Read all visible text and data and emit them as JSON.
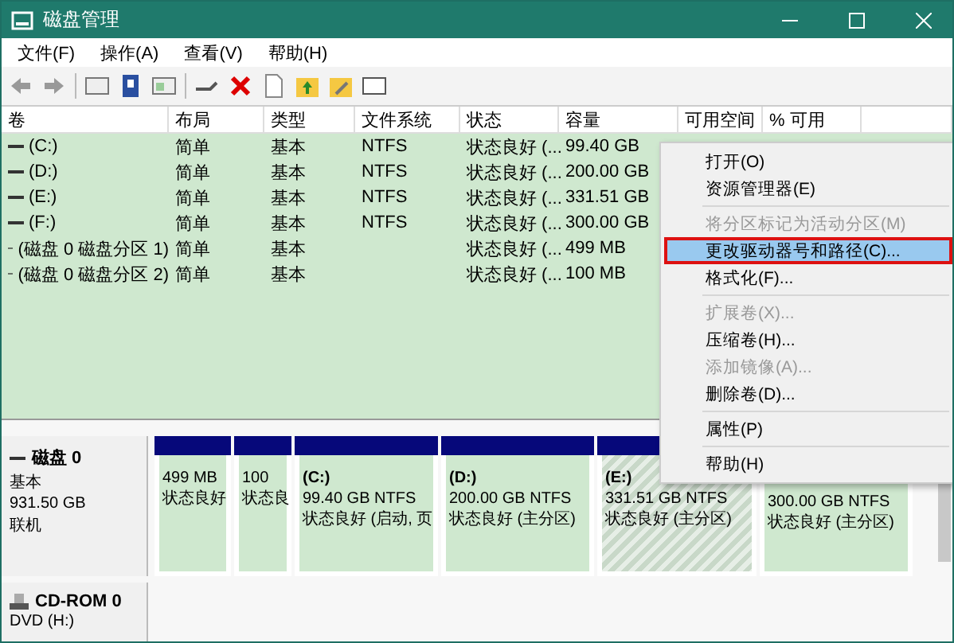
{
  "window": {
    "title": "磁盘管理"
  },
  "menu_bar": [
    "文件(F)",
    "操作(A)",
    "查看(V)",
    "帮助(H)"
  ],
  "table": {
    "columns": [
      "卷",
      "布局",
      "类型",
      "文件系统",
      "状态",
      "容量",
      "可用空间",
      "% 可用"
    ],
    "rows": [
      {
        "volume": "(C:)",
        "layout": "简单",
        "type": "基本",
        "filesystem": "NTFS",
        "status": "状态良好 (...",
        "capacity": "99.40 GB"
      },
      {
        "volume": "(D:)",
        "layout": "简单",
        "type": "基本",
        "filesystem": "NTFS",
        "status": "状态良好 (...",
        "capacity": "200.00 GB"
      },
      {
        "volume": "(E:)",
        "layout": "简单",
        "type": "基本",
        "filesystem": "NTFS",
        "status": "状态良好 (...",
        "capacity": "331.51 GB"
      },
      {
        "volume": "(F:)",
        "layout": "简单",
        "type": "基本",
        "filesystem": "NTFS",
        "status": "状态良好 (...",
        "capacity": "300.00 GB"
      },
      {
        "volume": "(磁盘 0 磁盘分区 1)",
        "layout": "简单",
        "type": "基本",
        "status": "状态良好 (...",
        "capacity": "499 MB"
      },
      {
        "volume": "(磁盘 0 磁盘分区 2)",
        "layout": "简单",
        "type": "基本",
        "status": "状态良好 (...",
        "capacity": "100 MB"
      }
    ]
  },
  "disks": [
    {
      "name": "磁盘 0",
      "kind": "disk",
      "type": "基本",
      "size": "931.50 GB",
      "status": "联机",
      "partitions": [
        {
          "size": "499 MB",
          "status": "状态良好",
          "selected": false
        },
        {
          "size": "100",
          "status": "状态良",
          "selected": false
        },
        {
          "name": "(C:)",
          "size": "99.40 GB NTFS",
          "status": "状态良好 (启动, 页",
          "selected": false
        },
        {
          "name": "(D:)",
          "size": "200.00 GB NTFS",
          "status": "状态良好 (主分区)",
          "selected": false
        },
        {
          "name": "(E:)",
          "size": "331.51 GB NTFS",
          "status": "状态良好 (主分区)",
          "selected": true
        },
        {
          "size": "300.00 GB NTFS",
          "status": "状态良好 (主分区)",
          "selected": false
        }
      ]
    },
    {
      "name": "CD-ROM 0",
      "kind": "cdrom",
      "type": "DVD (H:)"
    }
  ],
  "context_menu": {
    "items": [
      {
        "kind": "item",
        "label": "打开(O)",
        "disabled": false,
        "selected": false
      },
      {
        "kind": "item",
        "label": "资源管理器(E)",
        "disabled": false,
        "selected": false
      },
      {
        "kind": "separator"
      },
      {
        "kind": "item",
        "label": "将分区标记为活动分区(M)",
        "disabled": true,
        "selected": false
      },
      {
        "kind": "item",
        "label": "更改驱动器号和路径(C)...",
        "disabled": false,
        "selected": true
      },
      {
        "kind": "item",
        "label": "格式化(F)...",
        "disabled": false,
        "selected": false
      },
      {
        "kind": "separator"
      },
      {
        "kind": "item",
        "label": "扩展卷(X)...",
        "disabled": true,
        "selected": false
      },
      {
        "kind": "item",
        "label": "压缩卷(H)...",
        "disabled": false,
        "selected": false
      },
      {
        "kind": "item",
        "label": "添加镜像(A)...",
        "disabled": true,
        "selected": false
      },
      {
        "kind": "item",
        "label": "删除卷(D)...",
        "disabled": false,
        "selected": false
      },
      {
        "kind": "separator"
      },
      {
        "kind": "item",
        "label": "属性(P)",
        "disabled": false,
        "selected": false
      },
      {
        "kind": "separator"
      },
      {
        "kind": "item",
        "label": "帮助(H)",
        "disabled": false,
        "selected": false
      }
    ]
  }
}
